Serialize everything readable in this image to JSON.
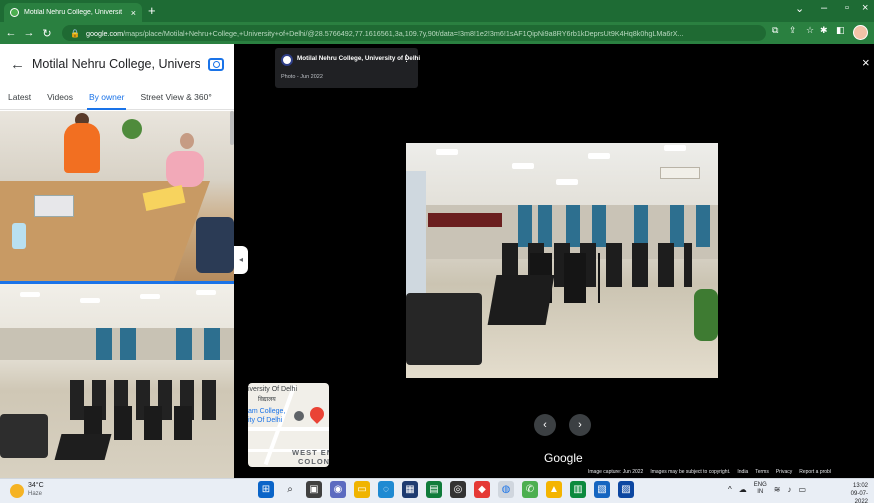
{
  "browser": {
    "tab_title": "Motilal Nehru College, Universit",
    "url_domain": "google.com",
    "url_path": "/maps/place/Motilal+Nehru+College,+University+of+Delhi/@28.5766492,77.1616561,3a,109.7y,90t/data=!3m8!1e2!3m6!1sAF1QipNi9a8RY6rb1kDeprsUt9K4Hq8k0hgLMa6rX..."
  },
  "panel": {
    "place_name": "Motilal Nehru College, University ...",
    "tabs": [
      "Latest",
      "Videos",
      "By owner",
      "Street View & 360°"
    ],
    "active_tab_index": 2
  },
  "viewer": {
    "card_title": "Motilal Nehru College, University of Delhi",
    "card_date": "Photo - Jun 2022",
    "brand": "Google",
    "minimap": {
      "label1": "iversity Of Delhi",
      "label2": "विद्यालय",
      "label3": "am College,",
      "label4": "ity Of Delhi",
      "label5": "WEST EN",
      "label6": "COLON"
    },
    "footer": [
      "Image capture: Jun 2022",
      "Images may be subject to copyright.",
      "India",
      "Terms",
      "Privacy",
      "Report a probl"
    ]
  },
  "taskbar": {
    "temperature": "34°C",
    "weather": "Haze",
    "lang_top": "ENG",
    "lang_bottom": "IN",
    "time": "13:02",
    "date": "09-07-2022"
  },
  "colors": {
    "chrome_green": "#1e6b34",
    "accent_blue": "#1a73e8",
    "pin_red": "#ea4335"
  }
}
